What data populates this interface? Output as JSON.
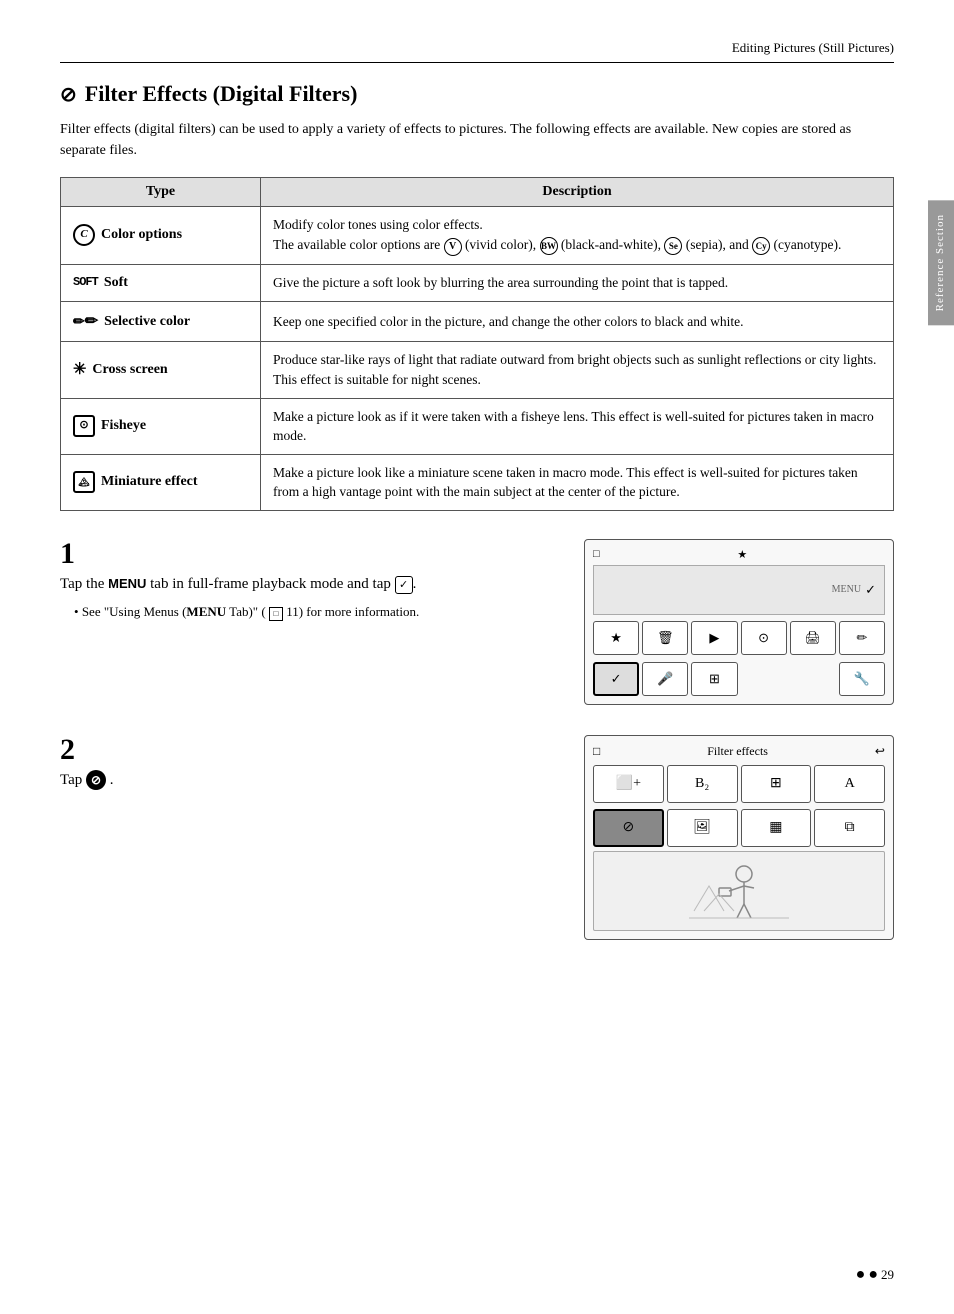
{
  "header": {
    "title": "Editing Pictures (Still Pictures)"
  },
  "section": {
    "icon": "🚫",
    "title": "Filter Effects (Digital Filters)",
    "intro": "Filter effects (digital filters) can be used to apply a variety of effects to pictures. The following effects are available. New copies are stored as separate files."
  },
  "table": {
    "col_type": "Type",
    "col_desc": "Description",
    "rows": [
      {
        "type": "Color options",
        "icon": "color-options",
        "description": "Modify color tones using color effects. The available color options are  (vivid color),  (black-and-white),  (sepia), and  (cyanotype)."
      },
      {
        "type": "Soft",
        "icon": "soft",
        "description": "Give the picture a soft look by blurring the area surrounding the point that is tapped."
      },
      {
        "type": "Selective color",
        "icon": "selective",
        "description": "Keep one specified color in the picture, and change the other colors to black and white."
      },
      {
        "type": "Cross screen",
        "icon": "cross",
        "description": "Produce star-like rays of light that radiate outward from bright objects such as sunlight reflections or city lights. This effect is suitable for night scenes."
      },
      {
        "type": "Fisheye",
        "icon": "fisheye",
        "description": "Make a picture look as if it were taken with a fisheye lens. This effect is well-suited for pictures taken in macro mode."
      },
      {
        "type": "Miniature effect",
        "icon": "miniature",
        "description": "Make a picture look like a miniature scene taken in macro mode. This effect is well-suited for pictures taken from a high vantage point with the main subject at the center of the picture."
      }
    ]
  },
  "steps": [
    {
      "number": "1",
      "text": "Tap the MENU tab in full-frame playback mode and tap ✓.",
      "note": "See \"Using Menus (MENU Tab)\" (  11) for more information."
    },
    {
      "number": "2",
      "text": "Tap  ."
    }
  ],
  "sidebar_label": "Reference Section",
  "footer_page": "29",
  "camera_ui": {
    "title": "★",
    "menu_label": "MENU",
    "row1": [
      "★",
      "🗑",
      "▶|",
      "⊙",
      "🖨",
      "✏"
    ],
    "row2": [
      "✓",
      "🎤",
      "⊞",
      "",
      "",
      "🔧"
    ]
  },
  "filter_ui": {
    "title": "Filter effects",
    "back_icon": "↩",
    "row1": [
      "⬜+",
      "B₂",
      "⊞⊞",
      "A"
    ],
    "row2": [
      "●",
      "🖼",
      "⬛⬛",
      "⧉"
    ]
  }
}
